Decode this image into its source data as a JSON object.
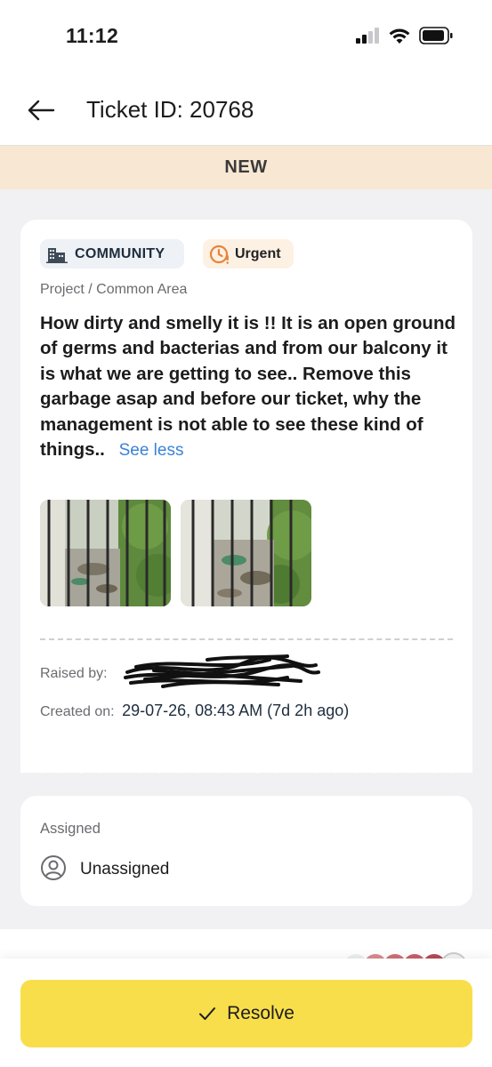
{
  "status_bar": {
    "time": "11:12"
  },
  "header": {
    "title": "Ticket ID: 20768"
  },
  "ticket_status": "NEW",
  "ticket": {
    "category": "COMMUNITY",
    "priority": "Urgent",
    "breadcrumb": "Project / Common Area",
    "description": "How dirty and smelly it is !! It is an open ground of germs and bacterias and from our balcony it is what we are getting to see.. Remove this garbage asap and before our ticket, why the management is not able to see these kind of things..",
    "see_less_label": "See less",
    "raised_by_label": "Raised by:",
    "created_label": "Created on:",
    "created_value": "29-07-26, 08:43 AM (7d 2h ago)"
  },
  "assignment": {
    "label": "Assigned",
    "value": "Unassigned"
  },
  "actions": {
    "resolve_label": "Resolve"
  },
  "colors": {
    "accent_yellow": "#f8de4a",
    "status_banner": "#f8e8d3",
    "link_blue": "#3b82d6",
    "urgent_orange": "#e8833a"
  },
  "icons": {
    "back": "arrow-left-icon",
    "category": "building-icon",
    "priority": "clock-alert-icon",
    "assignee": "user-circle-icon",
    "resolve": "check-icon"
  }
}
